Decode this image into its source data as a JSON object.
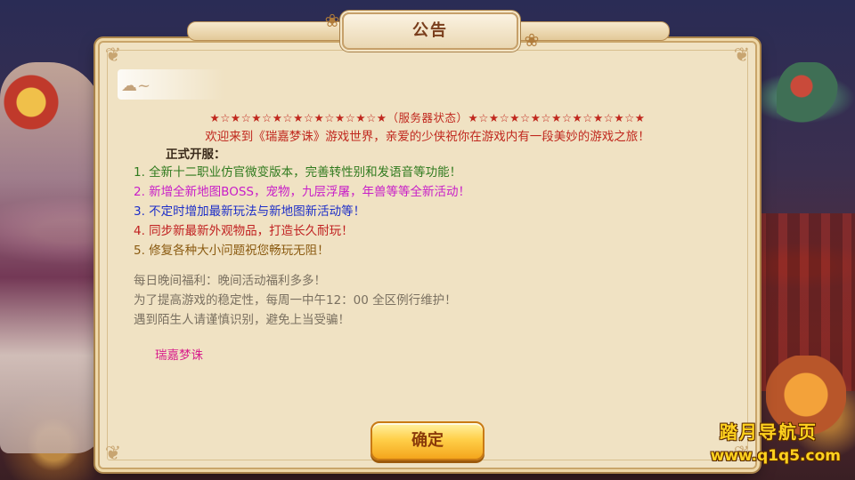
{
  "dialog": {
    "title": "公告",
    "confirm_label": "确定"
  },
  "notice": {
    "server_status": "★☆★☆★☆★☆★☆★☆★☆★☆★（服务器状态）★☆★☆★☆★☆★☆★☆★☆★☆★",
    "welcome": "欢迎来到《瑞嘉梦诛》游戏世界，亲爱的少侠祝你在游戏内有一段美妙的游戏之旅！",
    "heading": "正式开服：",
    "items": [
      "1. 全新十二职业仿官微变版本，完善转性别和发语音等功能！",
      "2. 新增全新地图BOSS，宠物，九层浮屠，年兽等等全新活动！",
      "3. 不定时增加最新玩法与新地图新活动等！",
      "4. 同步新最新外观物品，打造长久耐玩！",
      "5. 修复各种大小问题祝您畅玩无阻！"
    ],
    "info": [
      "每日晚间福利：晚间活动福利多多！",
      "为了提高游戏的稳定性，每周一中午12：00 全区例行维护！",
      "遇到陌生人请谨慎识别，避免上当受骗！"
    ],
    "signature": "瑞嘉梦诛"
  },
  "watermark": {
    "name": "踏月导航页",
    "url": "www.q1q5.com"
  },
  "colors": {
    "panel_bg": "#f0e2c3",
    "status_red": "#c0281e",
    "item_green": "#2f7a1e",
    "item_magenta": "#c81ec8",
    "item_blue": "#1e2fc8",
    "item_red": "#c02020",
    "item_brown": "#8a5a10",
    "info_gray": "#7a7060",
    "signature_pink": "#d81e8c",
    "button_gold": "#ffd04a",
    "watermark_yellow": "#ffd21e"
  },
  "icons": {
    "corner": "corner-ornament-icon",
    "lotus": "lotus-ornament-icon",
    "cloud": "cloud-ornament-icon"
  }
}
